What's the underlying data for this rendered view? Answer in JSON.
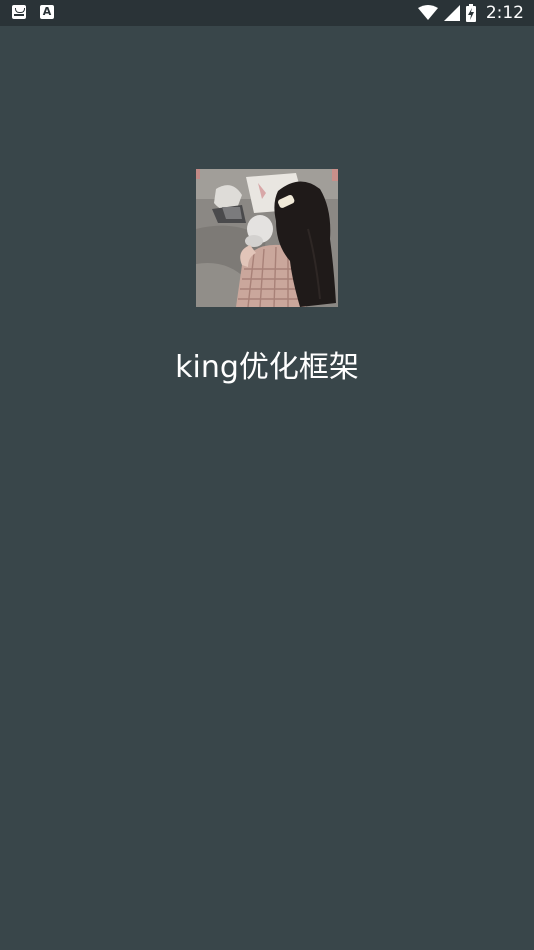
{
  "status_bar": {
    "time": "2:12",
    "left_icons": [
      "mail-icon",
      "font-a-icon"
    ],
    "left_icon_a_glyph": "A",
    "right_icons": [
      "wifi-icon",
      "cellular-signal-icon",
      "battery-charging-icon"
    ]
  },
  "splash": {
    "app_name": "king优化框架"
  },
  "colors": {
    "background": "#39464a",
    "status_bar": "#2a3337",
    "text": "#ffffff"
  }
}
